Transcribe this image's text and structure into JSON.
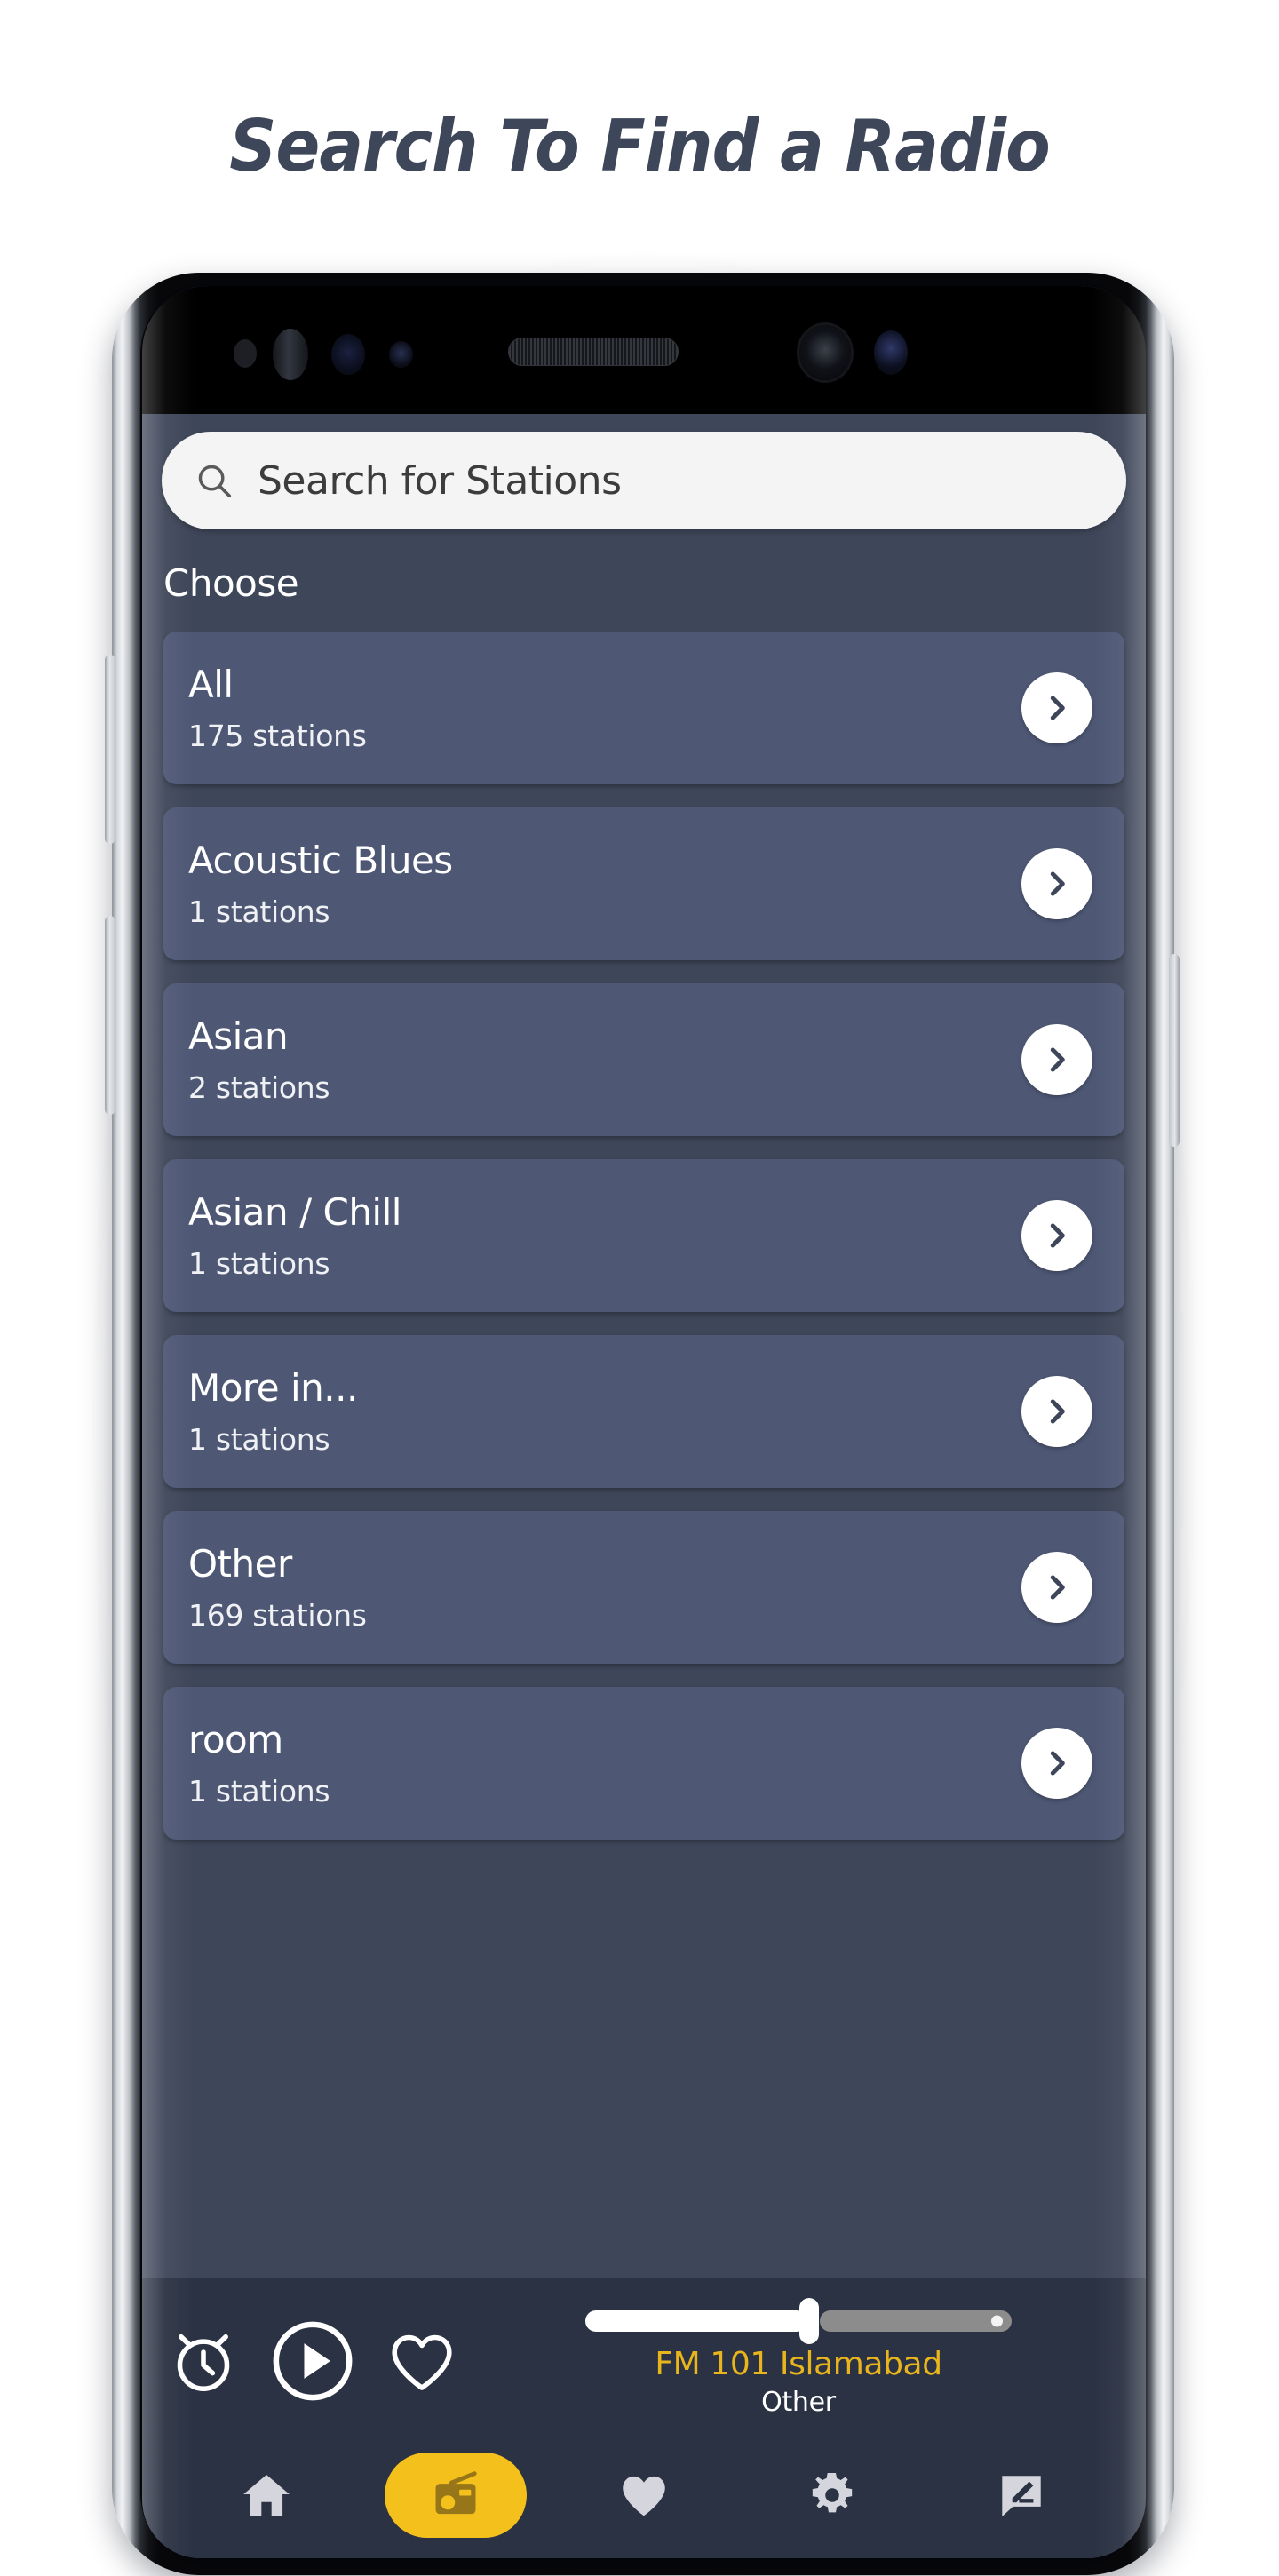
{
  "headline": "Search To Find a Radio",
  "colors": {
    "headline": "#3e4659",
    "app_background": "#3e4659",
    "card": "#4e5875",
    "player_bar": "#2b3243",
    "accent_yellow": "#f4c01c",
    "station_name": "#e8b51d",
    "search_bar": "#f4f4f4"
  },
  "search": {
    "placeholder": "Search for Stations",
    "value": "",
    "icon": "search-icon"
  },
  "section": {
    "header": "Choose"
  },
  "categories": [
    {
      "title": "All",
      "subtitle": "175 stations",
      "chevron": "chevron-right-icon"
    },
    {
      "title": "Acoustic Blues",
      "subtitle": "1 stations",
      "chevron": "chevron-right-icon"
    },
    {
      "title": "Asian",
      "subtitle": "2 stations",
      "chevron": "chevron-right-icon"
    },
    {
      "title": "Asian / Chill",
      "subtitle": "1 stations",
      "chevron": "chevron-right-icon"
    },
    {
      "title": "More in...",
      "subtitle": "1 stations",
      "chevron": "chevron-right-icon"
    },
    {
      "title": "Other",
      "subtitle": "169 stations",
      "chevron": "chevron-right-icon"
    },
    {
      "title": "room",
      "subtitle": "1 stations",
      "chevron": "chevron-right-icon"
    }
  ],
  "player": {
    "sleep_timer_icon": "alarm-clock-icon",
    "play_icon": "play-circle-icon",
    "favorite_icon": "heart-outline-icon",
    "volume_percent": 52,
    "station_name": "FM 101 Islamabad",
    "station_genre": "Other"
  },
  "navbar": {
    "items": [
      {
        "icon": "home-icon",
        "active": false
      },
      {
        "icon": "radio-icon",
        "active": true
      },
      {
        "icon": "heart-icon",
        "active": false
      },
      {
        "icon": "gear-icon",
        "active": false
      },
      {
        "icon": "feedback-icon",
        "active": false
      }
    ]
  }
}
